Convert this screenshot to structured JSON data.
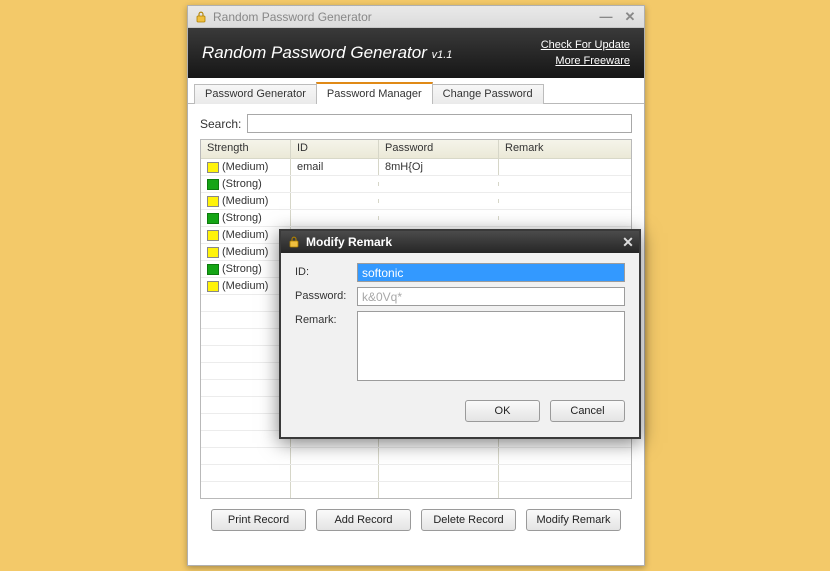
{
  "window": {
    "title": "Random Password Generator"
  },
  "banner": {
    "title": "Random Password Generator",
    "version": "v1.1",
    "link_update": "Check For Update",
    "link_freeware": "More Freeware"
  },
  "tabs": {
    "generator": "Password Generator",
    "manager": "Password Manager",
    "change": "Change Password"
  },
  "search": {
    "label": "Search:",
    "value": ""
  },
  "grid": {
    "headers": {
      "strength": "Strength",
      "id": "ID",
      "password": "Password",
      "remark": "Remark"
    },
    "rows": [
      {
        "strength_class": "med",
        "strength": "(Medium)",
        "id": "email",
        "password": "8mH{Oj",
        "remark": ""
      },
      {
        "strength_class": "str",
        "strength": "(Strong)",
        "id": "",
        "password": "",
        "remark": ""
      },
      {
        "strength_class": "med",
        "strength": "(Medium)",
        "id": "",
        "password": "",
        "remark": ""
      },
      {
        "strength_class": "str",
        "strength": "(Strong)",
        "id": "",
        "password": "",
        "remark": ""
      },
      {
        "strength_class": "med",
        "strength": "(Medium)",
        "id": "",
        "password": "",
        "remark": ""
      },
      {
        "strength_class": "med",
        "strength": "(Medium)",
        "id": "",
        "password": "",
        "remark": ""
      },
      {
        "strength_class": "str",
        "strength": "(Strong)",
        "id": "",
        "password": "",
        "remark": ""
      },
      {
        "strength_class": "med",
        "strength": "(Medium)",
        "id": "",
        "password": "",
        "remark": ""
      }
    ]
  },
  "buttons": {
    "print": "Print Record",
    "add": "Add Record",
    "delete": "Delete Record",
    "modify": "Modify Remark"
  },
  "dialog": {
    "title": "Modify Remark",
    "id_label": "ID:",
    "id_value": "softonic",
    "password_label": "Password:",
    "password_value": "k&0Vq*",
    "remark_label": "Remark:",
    "remark_value": "",
    "ok": "OK",
    "cancel": "Cancel"
  }
}
